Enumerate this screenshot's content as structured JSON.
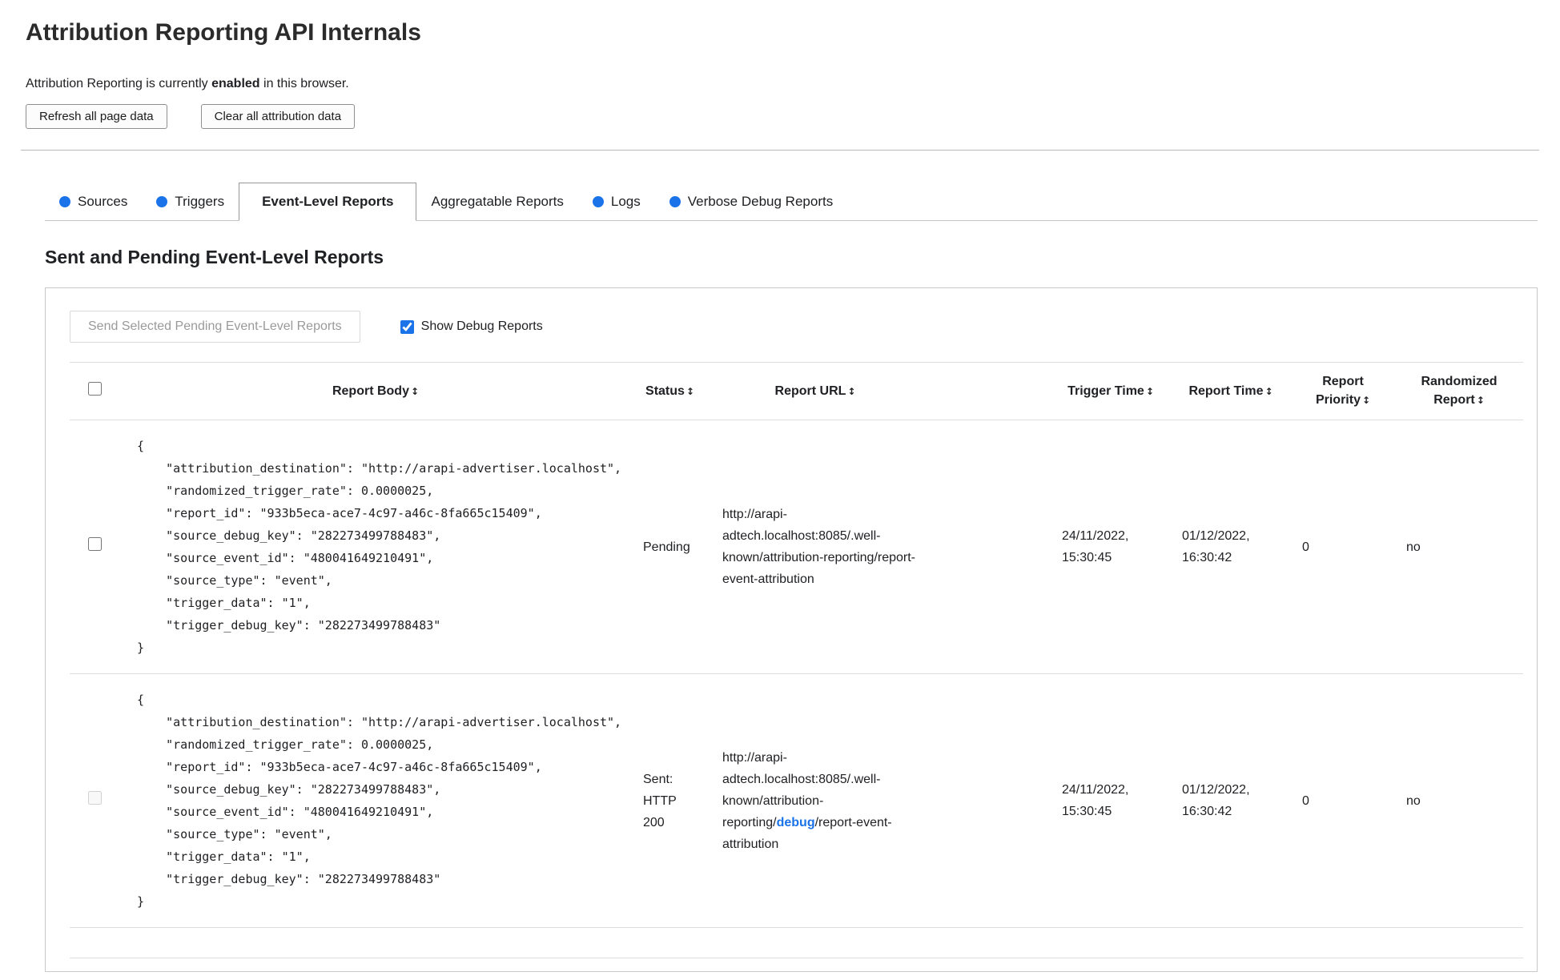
{
  "colors": {
    "accent_blue": "#1a73e8"
  },
  "header": {
    "title": "Attribution Reporting API Internals",
    "status": {
      "prefix": "Attribution Reporting is currently ",
      "bold": "enabled",
      "suffix": " in this browser."
    },
    "buttons": {
      "refresh": "Refresh all page data",
      "clear": "Clear all attribution data"
    }
  },
  "tabs": [
    {
      "label": "Sources",
      "has_dot": true,
      "active": false
    },
    {
      "label": "Triggers",
      "has_dot": true,
      "active": false
    },
    {
      "label": "Event-Level Reports",
      "has_dot": false,
      "active": true
    },
    {
      "label": "Aggregatable Reports",
      "has_dot": false,
      "active": false
    },
    {
      "label": "Logs",
      "has_dot": true,
      "active": false
    },
    {
      "label": "Verbose Debug Reports",
      "has_dot": true,
      "active": false
    }
  ],
  "section": {
    "heading": "Sent and Pending Event-Level Reports",
    "send_button": "Send Selected Pending Event-Level Reports",
    "show_debug": {
      "label": "Show Debug Reports",
      "checked": true
    }
  },
  "table": {
    "sort_glyph": "↕",
    "headers": [
      "Report Body",
      "Status",
      "Report URL",
      "Trigger Time",
      "Report Time",
      "Report Priority",
      "Randomized Report"
    ],
    "rows": [
      {
        "body": "{\n    \"attribution_destination\": \"http://arapi-advertiser.localhost\",\n    \"randomized_trigger_rate\": 0.0000025,\n    \"report_id\": \"933b5eca-ace7-4c97-a46c-8fa665c15409\",\n    \"source_debug_key\": \"282273499788483\",\n    \"source_event_id\": \"480041649210491\",\n    \"source_type\": \"event\",\n    \"trigger_data\": \"1\",\n    \"trigger_debug_key\": \"282273499788483\"\n}",
        "status": "Pending",
        "url": "http://arapi-adtech.localhost:8085/.well-known/attribution-reporting/report-event-attribution",
        "trigger_time": "24/11/2022, 15:30:45",
        "report_time": "01/12/2022, 16:30:42",
        "priority": "0",
        "randomized": "no"
      },
      {
        "body": "{\n    \"attribution_destination\": \"http://arapi-advertiser.localhost\",\n    \"randomized_trigger_rate\": 0.0000025,\n    \"report_id\": \"933b5eca-ace7-4c97-a46c-8fa665c15409\",\n    \"source_debug_key\": \"282273499788483\",\n    \"source_event_id\": \"480041649210491\",\n    \"source_type\": \"event\",\n    \"trigger_data\": \"1\",\n    \"trigger_debug_key\": \"282273499788483\"\n}",
        "status": "Sent: HTTP 200",
        "url_parts": {
          "prefix": "http://arapi-adtech.localhost:8085/.well-known/attribution-reporting/",
          "highlight": "debug",
          "suffix": "/report-event-attribution"
        },
        "trigger_time": "24/11/2022, 15:30:45",
        "report_time": "01/12/2022, 16:30:42",
        "priority": "0",
        "randomized": "no",
        "checkbox_disabled": true
      }
    ]
  }
}
